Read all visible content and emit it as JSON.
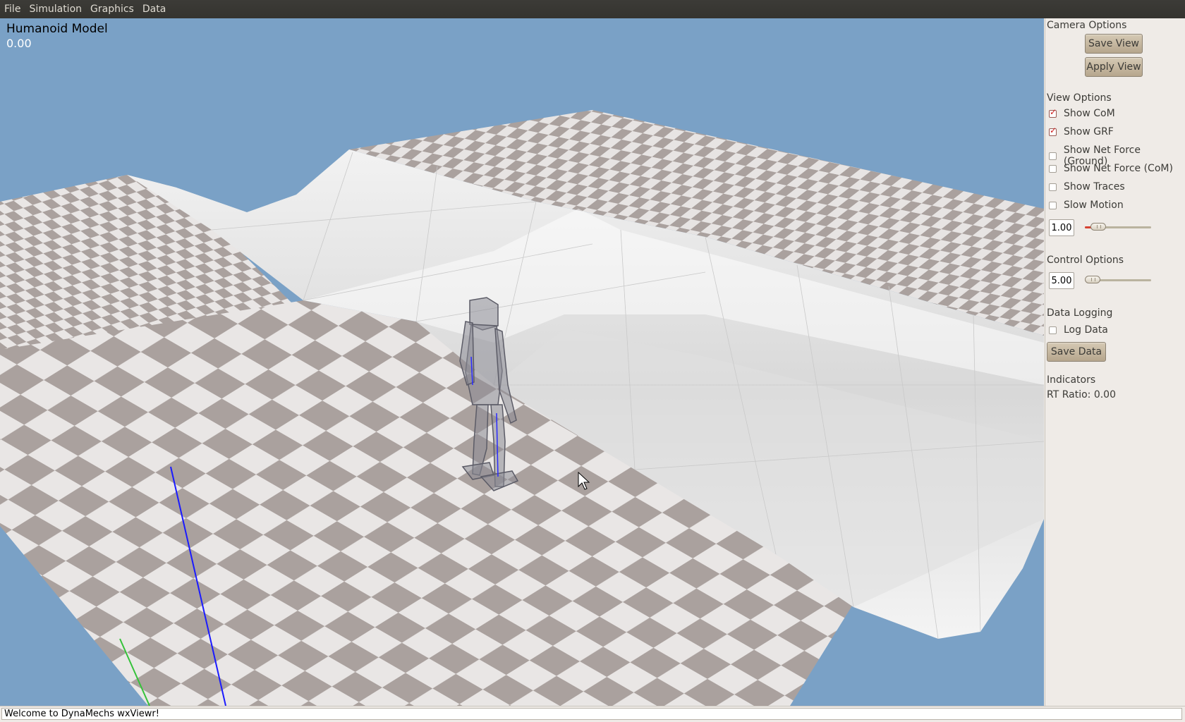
{
  "menu": [
    "File",
    "Simulation",
    "Graphics",
    "Data"
  ],
  "viewport": {
    "title": "Humanoid Model",
    "time": "0.00"
  },
  "panel": {
    "camera": {
      "label": "Camera Options",
      "save_view": "Save View",
      "apply_view": "Apply View"
    },
    "view": {
      "label": "View Options",
      "checks": [
        {
          "label": "Show CoM",
          "checked": true
        },
        {
          "label": "Show GRF",
          "checked": true
        },
        {
          "label": "Show Net Force (Ground)",
          "checked": false
        },
        {
          "label": "Show Net Force (CoM)",
          "checked": false
        },
        {
          "label": "Show Traces",
          "checked": false
        },
        {
          "label": "Slow Motion",
          "checked": false
        }
      ],
      "slow_value": "1.00",
      "slow_slider_fraction": 0.25
    },
    "control": {
      "label": "Control Options",
      "value": "5.00",
      "slider_fraction": 0.0
    },
    "logging": {
      "label": "Data Logging",
      "log_data": "Log Data",
      "log_checked": false,
      "save_data": "Save Data"
    },
    "indicators": {
      "label": "Indicators",
      "rt_ratio": "RT Ratio: 0.00"
    }
  },
  "status": "Welcome to DynaMechs wxViewr!",
  "colors": {
    "sky": "#7aa1c6",
    "checker_dark": "#aaa19e",
    "checker_light": "#e9e6e5",
    "hill": "#e8e8e8",
    "menubar": "#3c3b37"
  }
}
